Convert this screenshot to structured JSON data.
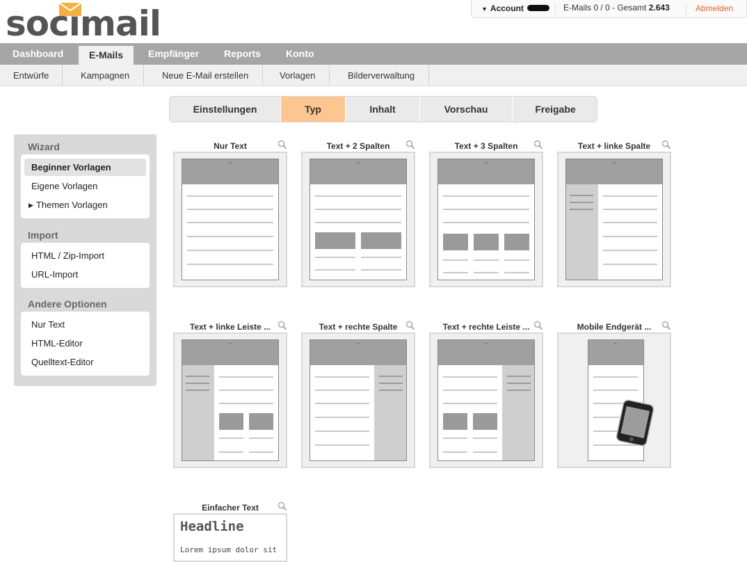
{
  "brand": {
    "logo_text": "socimail"
  },
  "account": {
    "label": "Account",
    "emails_prefix": "E-Mails 0 / 0 - Gesamt",
    "emails_total": "2.643",
    "logout": "Abmelden"
  },
  "mainnav": [
    "Dashboard",
    "E-Mails",
    "Empfänger",
    "Reports",
    "Konto"
  ],
  "subnav": [
    "Entwürfe",
    "Kampagnen",
    "Neue E-Mail erstellen",
    "Vorlagen",
    "Bilderverwaltung"
  ],
  "steps": [
    "Einstellungen",
    "Typ",
    "Inhalt",
    "Vorschau",
    "Freigabe"
  ],
  "active_step": "Typ",
  "sidebar": {
    "wizard": {
      "heading": "Wizard",
      "items": [
        "Beginner Vorlagen",
        "Eigene Vorlagen",
        "Themen Vorlagen"
      ]
    },
    "import": {
      "heading": "Import",
      "items": [
        "HTML / Zip-Import",
        "URL-Import"
      ]
    },
    "other": {
      "heading": "Andere Optionen",
      "items": [
        "Nur Text",
        "HTML-Editor",
        "Quelltext-Editor"
      ]
    }
  },
  "templates": [
    "Nur Text",
    "Text + 2 Spalten",
    "Text + 3 Spalten",
    "Text + linke Spalte",
    "Text + linke Leiste ...",
    "Text + rechte Spalte",
    "Text + rechte Leiste ...",
    "Mobile Endgerät ...",
    "Einfacher Text"
  ],
  "simple_preview": {
    "headline": "Headline",
    "body": "Lorem ipsum dolor sit"
  },
  "colors": {
    "accent_step": "#fdc691",
    "logout": "#e0662a",
    "nav_bg": "#a6a6a6"
  }
}
